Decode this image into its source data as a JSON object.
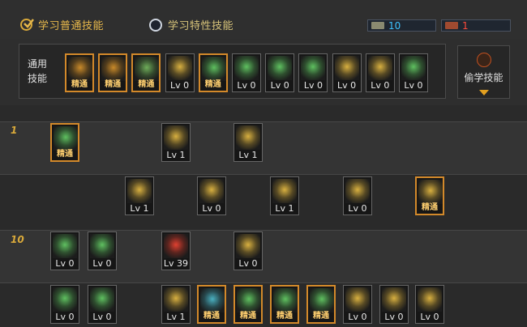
{
  "tabs": {
    "normal": "学习普通技能",
    "special": "学习特性技能"
  },
  "currency": {
    "sp": "10",
    "tp": "1",
    "sp_color": "#3ec3ff",
    "tp_color": "#ff4a3a"
  },
  "common_label": "通用\n技能",
  "steal_label": "偷学技能",
  "adv_text": "精通",
  "common_skills": [
    {
      "lvl": "精通",
      "adv": true,
      "c": "#c98a2a"
    },
    {
      "lvl": "精通",
      "adv": true,
      "c": "#c98a2a"
    },
    {
      "lvl": "精通",
      "adv": true,
      "c": "#6fae5a"
    },
    {
      "lvl": "Lv 0",
      "adv": false,
      "c": "#d8b040"
    },
    {
      "lvl": "精通",
      "adv": true,
      "c": "#5fc060"
    },
    {
      "lvl": "Lv 0",
      "adv": false,
      "c": "#5fc060"
    },
    {
      "lvl": "Lv 0",
      "adv": false,
      "c": "#5fc060"
    },
    {
      "lvl": "Lv 0",
      "adv": false,
      "c": "#5fc060"
    },
    {
      "lvl": "Lv 0",
      "adv": false,
      "c": "#d8b040"
    },
    {
      "lvl": "Lv 0",
      "adv": false,
      "c": "#d8b040"
    },
    {
      "lvl": "Lv 0",
      "adv": false,
      "c": "#5fc060"
    }
  ],
  "rows": [
    {
      "label": "1",
      "skills": [
        {
          "lvl": "精通",
          "adv": true,
          "c": "#5fc060"
        },
        {
          "lvl": "Lv 1",
          "adv": false,
          "c": "#d8b040"
        },
        {
          "lvl": "Lv 1",
          "adv": false,
          "c": "#d8b040"
        }
      ]
    },
    {
      "label": "",
      "skills": [
        {
          "lvl": "Lv 1",
          "adv": false,
          "c": "#d8b040"
        },
        {
          "lvl": "Lv 0",
          "adv": false,
          "c": "#d8b040"
        },
        {
          "lvl": "Lv 1",
          "adv": false,
          "c": "#d8b040"
        },
        {
          "lvl": "Lv 0",
          "adv": false,
          "c": "#d8b040"
        },
        {
          "lvl": "精通",
          "adv": true,
          "c": "#d8b040"
        }
      ]
    },
    {
      "label": "10",
      "skills": [
        {
          "lvl": "Lv 0",
          "adv": false,
          "c": "#5fc060"
        },
        {
          "lvl": "Lv 0",
          "adv": false,
          "c": "#5fc060"
        },
        {
          "lvl": "Lv 39",
          "adv": false,
          "c": "#e04030"
        },
        {
          "lvl": "Lv 0",
          "adv": false,
          "c": "#d8b040"
        }
      ]
    },
    {
      "label": "",
      "skills": [
        {
          "lvl": "Lv 0",
          "adv": false,
          "c": "#5fc060"
        },
        {
          "lvl": "Lv 0",
          "adv": false,
          "c": "#5fc060"
        },
        {
          "lvl": "Lv 1",
          "adv": false,
          "c": "#d8b040"
        },
        {
          "lvl": "精通",
          "adv": true,
          "c": "#4ab0c0"
        },
        {
          "lvl": "精通",
          "adv": true,
          "c": "#5fc060"
        },
        {
          "lvl": "精通",
          "adv": true,
          "c": "#5fc060"
        },
        {
          "lvl": "精通",
          "adv": true,
          "c": "#5fc060"
        },
        {
          "lvl": "Lv 0",
          "adv": false,
          "c": "#d8b040"
        },
        {
          "lvl": "Lv 0",
          "adv": false,
          "c": "#d8b040"
        },
        {
          "lvl": "Lv 0",
          "adv": false,
          "c": "#d8b040"
        }
      ]
    }
  ]
}
